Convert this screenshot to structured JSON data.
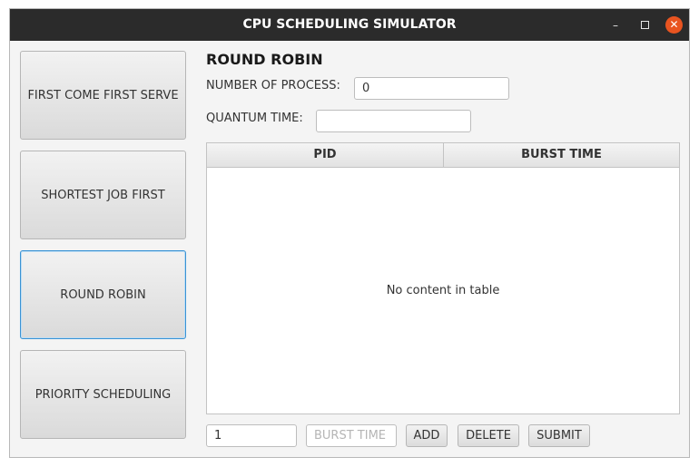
{
  "window": {
    "title": "CPU SCHEDULING SIMULATOR",
    "controls": {
      "minimize": "–",
      "close": "✕"
    }
  },
  "sidebar": {
    "items": [
      {
        "label": "FIRST COME FIRST SERVE",
        "active": false
      },
      {
        "label": "SHORTEST JOB FIRST",
        "active": false
      },
      {
        "label": "ROUND ROBIN",
        "active": true
      },
      {
        "label": "PRIORITY SCHEDULING",
        "active": false
      }
    ]
  },
  "main": {
    "heading": "ROUND ROBIN",
    "num_process_label": "NUMBER OF PROCESS:",
    "num_process_value": "0",
    "quantum_label": "QUANTUM TIME:",
    "quantum_value": "",
    "table": {
      "columns": [
        "PID",
        "BURST TIME"
      ],
      "rows": [],
      "empty_message": "No content in table"
    },
    "footer": {
      "pid_value": "1",
      "burst_placeholder": "BURST TIME",
      "add_label": "ADD",
      "delete_label": "DELETE",
      "submit_label": "SUBMIT"
    }
  },
  "colors": {
    "titlebar": "#2b2b2b",
    "close_button": "#e95420",
    "active_border": "#3a93d4"
  }
}
